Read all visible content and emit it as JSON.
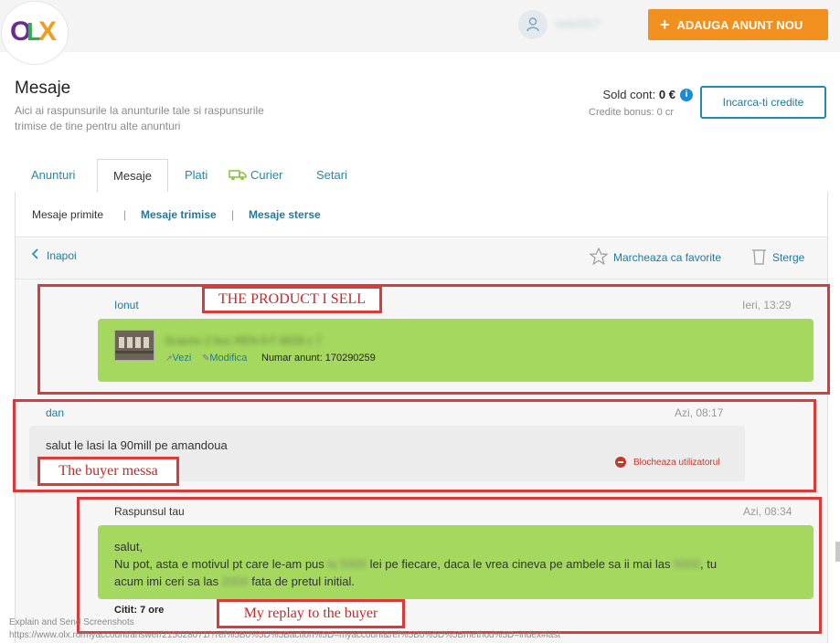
{
  "header": {
    "logo": {
      "o": "O",
      "l": "L",
      "x": "X"
    },
    "user_name": "sele2017",
    "add_button": {
      "plus": "+",
      "label": "ADAUGA ANUNT NOU"
    }
  },
  "page": {
    "title": "Mesaje",
    "subtitle": "Aici ai raspunsurile la anunturile tale si raspunsurile trimise de tine pentru alte anunturi",
    "sold_label": "Sold cont:",
    "sold_value": "0 €",
    "bonus_label": "Credite bonus:",
    "bonus_value": "0 cr",
    "credit_button": "Incarca-ti credite"
  },
  "tabs": [
    {
      "label": "Anunturi"
    },
    {
      "label": "Mesaje"
    },
    {
      "label": "Plati"
    },
    {
      "label": "Curier"
    },
    {
      "label": "Setari"
    }
  ],
  "subnav": {
    "received": "Mesaje primite",
    "sent": "Mesaje trimise",
    "deleted": "Mesaje sterse",
    "separator": "|"
  },
  "toolbar": {
    "back": "Inapoi",
    "favorite": "Marcheaza ca favorite",
    "delete": "Sterge"
  },
  "messages": {
    "product": {
      "sender": "Ionut",
      "time": "Ieri, 13:29",
      "ad_title": "Scaune 2 buc REN 8 F 8028 x 7",
      "view": "Vezi",
      "edit": "Modifica",
      "ad_number_label": "Numar anunt:",
      "ad_number": "170290259"
    },
    "buyer": {
      "sender": "dan",
      "time": "Azi, 08:17",
      "text": "salut le lasi la 90mill pe amandoua",
      "block": "Blocheaza utilizatorul"
    },
    "reply": {
      "label": "Raspunsul tau",
      "time": "Azi, 08:34",
      "line1": "salut,",
      "line2_a": "Nu pot, asta e motivul pt care le-am pus ",
      "line2_b": "la 5000",
      "line2_c": " lei pe fiecare, daca le vrea cineva pe ambele sa ii mai las ",
      "line2_d": "5000",
      "line2_e": ", tu",
      "line3_a": "acum imi ceri sa las ",
      "line3_b": "2000",
      "line3_c": " fata de pretul initial.",
      "read_label": "Citit:",
      "read_value": "7 ore"
    }
  },
  "annotations": {
    "product": "THE PRODUCT I SELL",
    "buyer": "The buyer messa",
    "reply": "My replay to the buyer"
  },
  "footer": {
    "line1": "Explain and Send Screenshots",
    "line2": "https://www.olx.ro/myaccount/answer/215028071/?ref%5B0%5D%5Baction%5D=myaccount&ref%5B0%5D%5Bmethod%5D=index#last"
  },
  "colors": {
    "accent_orange": "#f18f1f",
    "link_blue": "#1f8ab2",
    "message_green": "#a5d85f",
    "annotation_red": "#d93a3a"
  },
  "icons": [
    "user-icon",
    "plus-icon",
    "info-icon",
    "chevron-left-icon",
    "star-icon",
    "trash-icon",
    "courier-icon",
    "block-icon",
    "external-link-icon",
    "pencil-icon"
  ]
}
